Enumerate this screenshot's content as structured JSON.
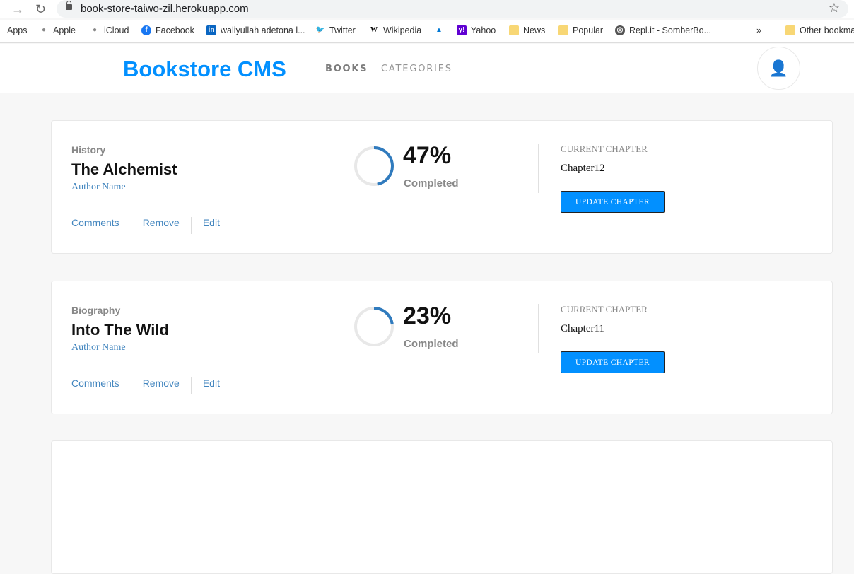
{
  "browser": {
    "url": "book-store-taiwo-zil.herokuapp.com",
    "bookmarks": [
      {
        "label": "Apps"
      },
      {
        "label": "Apple"
      },
      {
        "label": "iCloud"
      },
      {
        "label": "Facebook"
      },
      {
        "label": "waliyullah adetona l..."
      },
      {
        "label": "Twitter"
      },
      {
        "label": "Wikipedia"
      },
      {
        "label": ""
      },
      {
        "label": "Yahoo"
      },
      {
        "label": "News"
      },
      {
        "label": "Popular"
      },
      {
        "label": "Repl.it - SomberBo..."
      }
    ],
    "more": "»",
    "other": "Other bookmarks"
  },
  "header": {
    "logo": "Bookstore CMS",
    "nav": [
      "BOOKS",
      "CATEGORIES"
    ]
  },
  "books": [
    {
      "category": "History",
      "title": "The Alchemist",
      "author": "Author Name",
      "progress": 47,
      "percent_label": "47%",
      "completed": "Completed",
      "chapter_label": "CURRENT CHAPTER",
      "chapter": "Chapter12",
      "update": "UPDATE CHAPTER",
      "actions": [
        "Comments",
        "Remove",
        "Edit"
      ]
    },
    {
      "category": "Biography",
      "title": "Into The Wild",
      "author": "Author Name",
      "progress": 23,
      "percent_label": "23%",
      "completed": "Completed",
      "chapter_label": "CURRENT CHAPTER",
      "chapter": "Chapter11",
      "update": "UPDATE CHAPTER",
      "actions": [
        "Comments",
        "Remove",
        "Edit"
      ]
    }
  ],
  "colors": {
    "accent": "#0290ff",
    "ring": "#307bbe"
  }
}
